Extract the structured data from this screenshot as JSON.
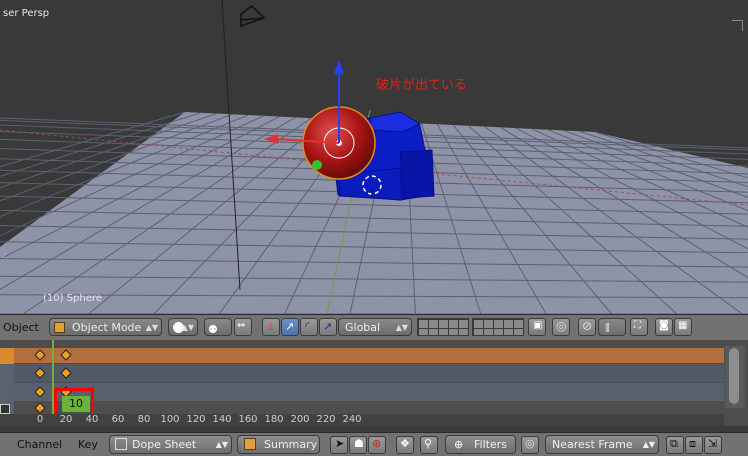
{
  "viewport": {
    "view_label": "ser Persp",
    "object_label": "(10) Sphere",
    "annotation": "破片が出ている",
    "colors": {
      "sphere": "#b01818",
      "fragments": "#0a1fc0",
      "grid": "#8f93a8"
    }
  },
  "header3d": {
    "object_menu": "Object",
    "mode": "Object Mode",
    "orientation": "Global",
    "icons": [
      "cube-icon",
      "shading-solid-icon",
      "pivot-icon",
      "manipulator-icon",
      "translate-icon",
      "rotate-icon",
      "scale-icon",
      "layers-icon",
      "lock-icon",
      "proportional-icon",
      "snap-icon",
      "snap-target-icon",
      "render-icon",
      "camera-icon",
      "clapper-icon"
    ]
  },
  "dopesheet": {
    "current_frame": "10",
    "ruler_ticks": [
      "0",
      "20",
      "40",
      "60",
      "80",
      "100",
      "120",
      "140",
      "160",
      "180",
      "200",
      "220",
      "240"
    ],
    "row_colors": [
      "#b27041",
      "#525a66",
      "#59606d",
      "#4e4e4e"
    ],
    "keyframes_frames": [
      0,
      20
    ],
    "highlight_color": "#ff0000",
    "frame_color": "#6ab23c"
  },
  "footer": {
    "channel_menu": "Channel",
    "key_menu": "Key",
    "editor": "Dope Sheet",
    "summary": "Summary",
    "filters": "Filters",
    "snap_mode": "Nearest Frame"
  }
}
